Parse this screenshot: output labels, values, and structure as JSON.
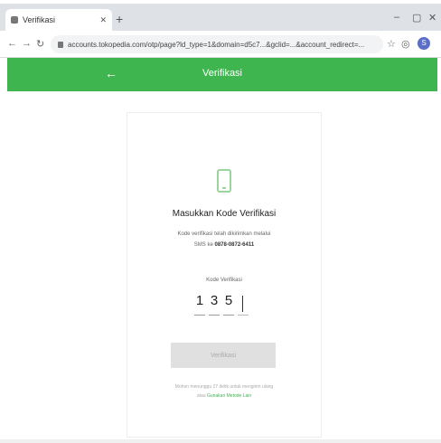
{
  "browser": {
    "tab_title": "Verifikasi",
    "url": "accounts.tokopedia.com/otp/page?ld_type=1&domain=d5c7...&gclid=...&account_redirect=...",
    "profile_initial": "S"
  },
  "app": {
    "header_title": "Verifikasi",
    "accent_color": "#3fb550"
  },
  "verification": {
    "heading": "Masukkan Kode Verifikasi",
    "description": "Kode verifikasi telah dikirimkan melalui",
    "description_line2": "SMS ke",
    "phone": "0878-0872-6411",
    "code_label": "Kode Verifikasi",
    "digits": [
      "1",
      "3",
      "5",
      ""
    ],
    "button_label": "Verifikasi",
    "resend_text": "Mohon menunggu 27 detik untuk mengirim ulang",
    "resend_prefix": "atau",
    "resend_link": "Gunakan Metode Lain"
  }
}
